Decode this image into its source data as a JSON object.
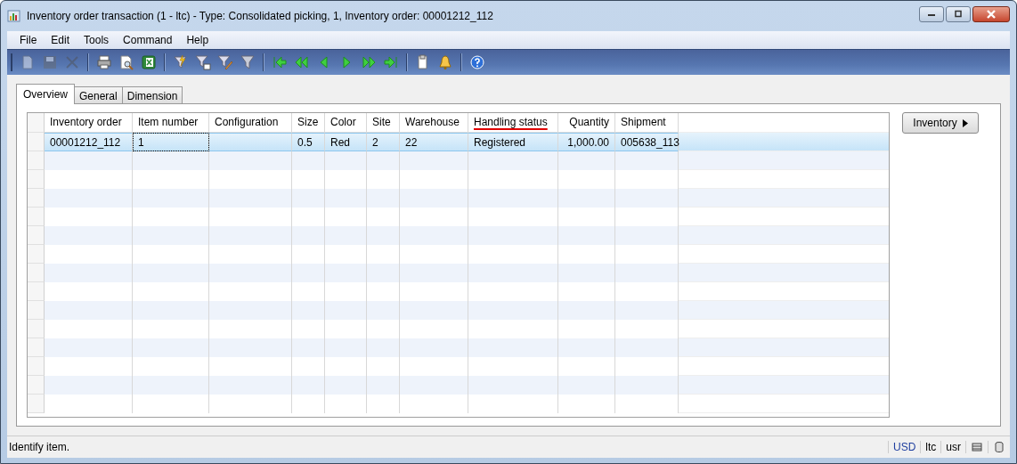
{
  "window": {
    "title": "Inventory order transaction (1 - ltc) - Type: Consolidated picking, 1, Inventory order: 00001212_112"
  },
  "menu": [
    "File",
    "Edit",
    "Tools",
    "Command",
    "Help"
  ],
  "toolbar": [
    {
      "kind": "new",
      "disabled": true
    },
    {
      "kind": "save",
      "disabled": true
    },
    {
      "kind": "delete",
      "disabled": true
    },
    {
      "kind": "separator"
    },
    {
      "kind": "print",
      "disabled": false
    },
    {
      "kind": "preview",
      "disabled": false
    },
    {
      "kind": "excel",
      "disabled": false
    },
    {
      "kind": "separator"
    },
    {
      "kind": "filter-selection",
      "disabled": false
    },
    {
      "kind": "filter-grid",
      "disabled": false
    },
    {
      "kind": "filter-edit",
      "disabled": false
    },
    {
      "kind": "filter",
      "disabled": false
    },
    {
      "kind": "separator"
    },
    {
      "kind": "first",
      "disabled": false
    },
    {
      "kind": "prev-page",
      "disabled": false
    },
    {
      "kind": "prev",
      "disabled": false
    },
    {
      "kind": "next",
      "disabled": false
    },
    {
      "kind": "next-page",
      "disabled": false
    },
    {
      "kind": "last",
      "disabled": false
    },
    {
      "kind": "separator"
    },
    {
      "kind": "document",
      "disabled": false
    },
    {
      "kind": "alert",
      "disabled": false
    },
    {
      "kind": "separator"
    },
    {
      "kind": "help",
      "disabled": false
    }
  ],
  "tabs": [
    {
      "label": "Overview",
      "selected": true
    },
    {
      "label": "General",
      "selected": false
    },
    {
      "label": "Dimension",
      "selected": false
    }
  ],
  "table": {
    "columns": [
      {
        "label": "Inventory order",
        "kind": "text",
        "underlined": false
      },
      {
        "label": "Item number",
        "kind": "text",
        "underlined": false
      },
      {
        "label": "Configuration",
        "kind": "text",
        "underlined": false
      },
      {
        "label": "Size",
        "kind": "text",
        "underlined": false
      },
      {
        "label": "Color",
        "kind": "text",
        "underlined": false
      },
      {
        "label": "Site",
        "kind": "text",
        "underlined": false
      },
      {
        "label": "Warehouse",
        "kind": "text",
        "underlined": false
      },
      {
        "label": "Handling status",
        "kind": "text",
        "underlined": true
      },
      {
        "label": "Quantity",
        "kind": "number",
        "underlined": false
      },
      {
        "label": "Shipment",
        "kind": "text",
        "underlined": false
      }
    ],
    "rows": [
      {
        "selected": true,
        "cells": [
          {
            "text": "00001212_112",
            "focused": false
          },
          {
            "text": "1",
            "focused": true
          },
          {
            "text": "",
            "focused": false
          },
          {
            "text": "0.5",
            "focused": false
          },
          {
            "text": "Red",
            "focused": false
          },
          {
            "text": "2",
            "focused": false
          },
          {
            "text": "22",
            "focused": false
          },
          {
            "text": "Registered",
            "focused": false
          },
          {
            "text": "1,000.00",
            "focused": false
          },
          {
            "text": "005638_113",
            "focused": false
          }
        ]
      }
    ]
  },
  "side_button": {
    "label": "Inventory"
  },
  "status_bar": {
    "message": "Identify item.",
    "currency": "USD",
    "company": "ltc",
    "user": "usr"
  }
}
